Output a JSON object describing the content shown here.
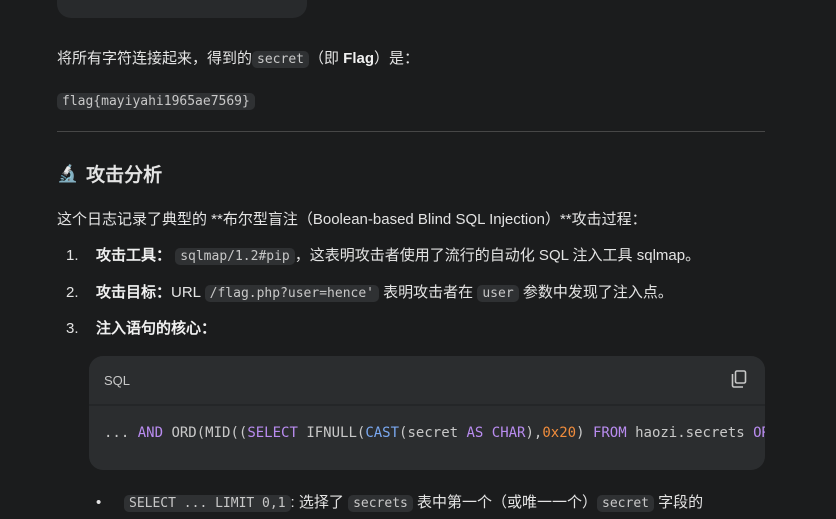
{
  "intro": {
    "pre": "将所有字符连接起来，得到的",
    "code": "secret",
    "mid": "（即 ",
    "bold": "Flag",
    "post": "）是："
  },
  "flag": "flag{mayiyahi1965ae7569}",
  "section": {
    "icon": "microscope-icon",
    "title": "攻击分析"
  },
  "desc": "这个日志记录了典型的 **布尔型盲注（Boolean-based Blind SQL Injection）**攻击过程：",
  "list": [
    {
      "num": "1.",
      "label": "攻击工具：",
      "code": "sqlmap/1.2#pip",
      "text": "，这表明攻击者使用了流行的自动化 SQL 注入工具 sqlmap。"
    },
    {
      "num": "2.",
      "label": "攻击目标：",
      "pre": "URL ",
      "code": "/flag.php?user=hence'",
      "mid": " 表明攻击者在 ",
      "code2": "user",
      "text": " 参数中发现了注入点。"
    },
    {
      "num": "3.",
      "label": "注入语句的核心："
    }
  ],
  "codeblock": {
    "lang": "SQL",
    "copy_icon": "copy-icon",
    "tokens": [
      "... ",
      "AND",
      " ORD(MID((",
      "SELECT",
      " IFNULL(",
      "CAST",
      "(secret ",
      "AS CHAR",
      "),",
      "0x20",
      ") ",
      "FROM",
      " haozi.secrets ",
      "ORDER"
    ]
  },
  "bullet": {
    "code": "SELECT ... LIMIT 0,1",
    "t1": ": 选择了 ",
    "code2": "secrets",
    "t2": " 表中第一个（或唯一一个）",
    "code3": "secret",
    "t3": " 字段的"
  },
  "colors": {
    "background": "#1b1c1d",
    "keyword": "#b98cf0",
    "function": "#7aa8f0",
    "number": "#f08c3c"
  }
}
